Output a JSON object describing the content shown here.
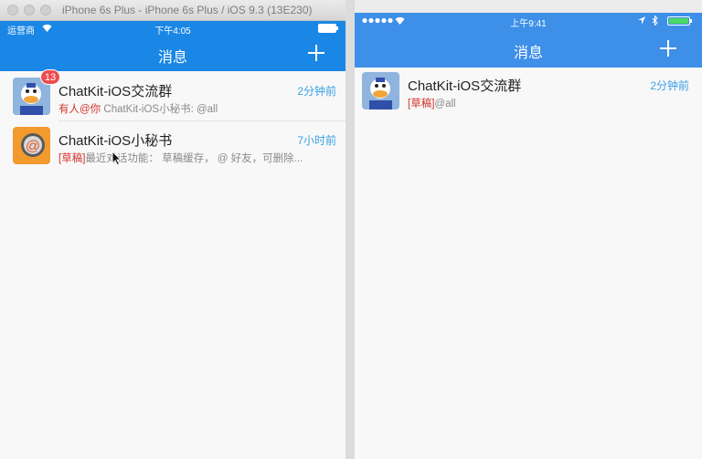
{
  "left": {
    "window_title": "iPhone 6s Plus - iPhone 6s Plus / iOS 9.3 (13E230)",
    "status": {
      "carrier": "运营商",
      "time": "下午4:05"
    },
    "nav": {
      "title": "消息"
    },
    "rows": [
      {
        "title": "ChatKit-iOS交流群",
        "time": "2分钟前",
        "badge": "13",
        "sub_prefix": "有人@你",
        "sub_text": " ChatKit-iOS小秘书: @all"
      },
      {
        "title": "ChatKit-iOS小秘书",
        "time": "7小时前",
        "sub_prefix": "[草稿]",
        "sub_text": "最近对话功能：  草稿缓存，  @ 好友，可删除..."
      }
    ]
  },
  "right": {
    "status": {
      "time": "上午9:41"
    },
    "nav": {
      "title": "消息"
    },
    "rows": [
      {
        "title": "ChatKit-iOS交流群",
        "time": "2分钟前",
        "sub_prefix": "[草稿]",
        "sub_text": "@all"
      }
    ]
  },
  "colors": {
    "nav_blue_left": "#1a87e6",
    "nav_blue_right": "#3d8fe8",
    "time_blue": "#3aa1e6",
    "badge_red": "#ee4d4d",
    "mention_red": "#d0342c"
  }
}
